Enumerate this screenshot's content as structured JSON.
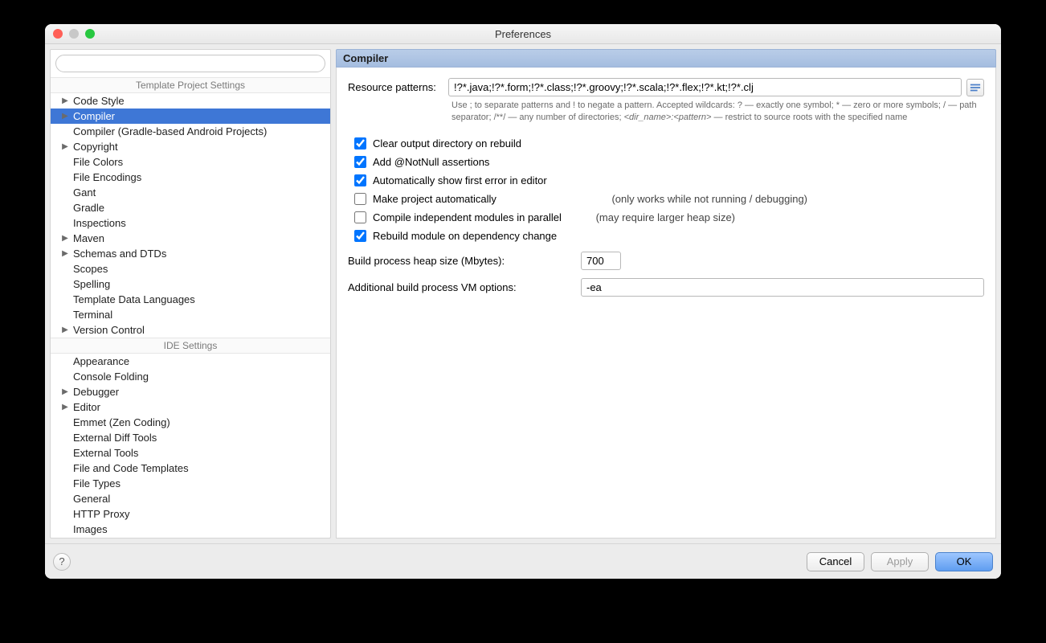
{
  "window": {
    "title": "Preferences"
  },
  "sidebar": {
    "section1": "Template Project Settings",
    "section2": "IDE Settings",
    "items1": [
      {
        "label": "Code Style",
        "arrow": true
      },
      {
        "label": "Compiler",
        "arrow": true,
        "selected": true
      },
      {
        "label": "Compiler (Gradle-based Android Projects)"
      },
      {
        "label": "Copyright",
        "arrow": true
      },
      {
        "label": "File Colors"
      },
      {
        "label": "File Encodings"
      },
      {
        "label": "Gant"
      },
      {
        "label": "Gradle"
      },
      {
        "label": "Inspections"
      },
      {
        "label": "Maven",
        "arrow": true
      },
      {
        "label": "Schemas and DTDs",
        "arrow": true
      },
      {
        "label": "Scopes"
      },
      {
        "label": "Spelling"
      },
      {
        "label": "Template Data Languages"
      },
      {
        "label": "Terminal"
      },
      {
        "label": "Version Control",
        "arrow": true
      }
    ],
    "items2": [
      {
        "label": "Appearance"
      },
      {
        "label": "Console Folding"
      },
      {
        "label": "Debugger",
        "arrow": true
      },
      {
        "label": "Editor",
        "arrow": true
      },
      {
        "label": "Emmet (Zen Coding)"
      },
      {
        "label": "External Diff Tools"
      },
      {
        "label": "External Tools"
      },
      {
        "label": "File and Code Templates"
      },
      {
        "label": "File Types"
      },
      {
        "label": "General"
      },
      {
        "label": "HTTP Proxy"
      },
      {
        "label": "Images"
      }
    ]
  },
  "main": {
    "title": "Compiler",
    "resource_label": "Resource patterns:",
    "resource_value": "!?*.java;!?*.form;!?*.class;!?*.groovy;!?*.scala;!?*.flex;!?*.kt;!?*.clj",
    "help_pre": "Use ; to separate patterns and ! to negate a pattern. Accepted wildcards: ? — exactly one symbol; * — zero or more symbols; / — path separator; /**/ — any number of directories; ",
    "help_em": "<dir_name>:<pattern>",
    "help_post": " — restrict to source roots with the specified name",
    "checks": [
      {
        "label": "Clear output directory on rebuild",
        "checked": true
      },
      {
        "label": "Add @NotNull assertions",
        "checked": true
      },
      {
        "label": "Automatically show first error in editor",
        "checked": true
      },
      {
        "label": "Make project automatically",
        "checked": false,
        "hint": "(only works while not running / debugging)"
      },
      {
        "label": "Compile independent modules in parallel",
        "checked": false,
        "hint": "(may require larger heap size)",
        "narrow": true
      },
      {
        "label": "Rebuild module on dependency change",
        "checked": true
      }
    ],
    "heap_label": "Build process heap size (Mbytes):",
    "heap_value": "700",
    "vm_label": "Additional build process VM options:",
    "vm_value": "-ea"
  },
  "footer": {
    "cancel": "Cancel",
    "apply": "Apply",
    "ok": "OK"
  }
}
